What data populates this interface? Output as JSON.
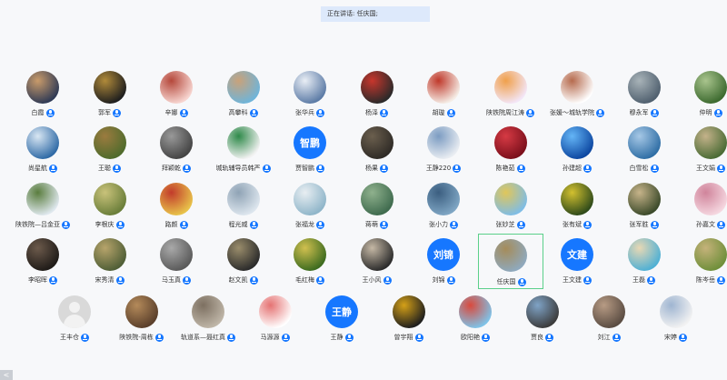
{
  "status": {
    "speaking_text": "正在讲话: 任庆国;"
  },
  "participants": [
    {
      "name": "白霞",
      "colors": [
        "#2f3a55",
        "#c99b6a"
      ]
    },
    {
      "name": "郭军",
      "colors": [
        "#1e1e1e",
        "#b08a3a"
      ]
    },
    {
      "name": "辛娜",
      "colors": [
        "#f7d5d0",
        "#b5483b"
      ]
    },
    {
      "name": "高攀科",
      "colors": [
        "#6fb4d9",
        "#c9a27a"
      ]
    },
    {
      "name": "张华兵",
      "colors": [
        "#5c7ba6",
        "#e9eef5"
      ]
    },
    {
      "name": "杨泽",
      "colors": [
        "#2a2a2a",
        "#c7362c"
      ]
    },
    {
      "name": "胡璇",
      "colors": [
        "#f5ede6",
        "#c0392b"
      ]
    },
    {
      "name": "陕铁院周江涛",
      "colors": [
        "#f3e6f7",
        "#f0a04b"
      ]
    },
    {
      "name": "张媛～城轨学院",
      "colors": [
        "#ffffff",
        "#b66b4e"
      ]
    },
    {
      "name": "穆永军",
      "colors": [
        "#50606f",
        "#a8b3b8"
      ]
    },
    {
      "name": "仲明",
      "colors": [
        "#3c6a2f",
        "#a9c48d"
      ]
    },
    {
      "name": "尚星航",
      "colors": [
        "#2f6aa6",
        "#d9e7f3"
      ]
    },
    {
      "name": "王聪",
      "colors": [
        "#4f6b2c",
        "#9b7b3f"
      ]
    },
    {
      "name": "拜颖乾",
      "colors": [
        "#444",
        "#999"
      ]
    },
    {
      "name": "城轨辅导员韩严",
      "colors": [
        "#f2f2f2",
        "#2f8a4a"
      ]
    },
    {
      "name": "贾智鹏",
      "text": "智鹏"
    },
    {
      "name": "杨果",
      "colors": [
        "#2f2b26",
        "#6b5f4e"
      ]
    },
    {
      "name": "王静220",
      "colors": [
        "#e9edf2",
        "#7c9cc2"
      ]
    },
    {
      "name": "陈艳茹",
      "colors": [
        "#7b0f1b",
        "#d63a44"
      ]
    },
    {
      "name": "孙建超",
      "colors": [
        "#0d47a1",
        "#64b5f6"
      ]
    },
    {
      "name": "白雪松",
      "colors": [
        "#2f6ea5",
        "#a6c8e6"
      ]
    },
    {
      "name": "王文娟",
      "colors": [
        "#4a6b35",
        "#c4b28a"
      ]
    },
    {
      "name": "陕铁院—吕金亚",
      "colors": [
        "#dfe8ee",
        "#5a7d3e"
      ]
    },
    {
      "name": "李根庆",
      "colors": [
        "#6a7e3a",
        "#c9c27a"
      ]
    },
    {
      "name": "路颜",
      "colors": [
        "#e8c34a",
        "#c23b2b"
      ]
    },
    {
      "name": "程光威",
      "colors": [
        "#dde6ee",
        "#8fa3b5"
      ]
    },
    {
      "name": "张福龙",
      "colors": [
        "#8fb5c9",
        "#e8eef2"
      ]
    },
    {
      "name": "蒋萌",
      "colors": [
        "#3f6b4e",
        "#8fb18d"
      ]
    },
    {
      "name": "张小力",
      "colors": [
        "#7fa6c4",
        "#3b5e80"
      ]
    },
    {
      "name": "张妙芝",
      "colors": [
        "#7fbde6",
        "#e0c65a"
      ]
    },
    {
      "name": "张有斌",
      "colors": [
        "#2e4a1a",
        "#d2c02f"
      ]
    },
    {
      "name": "张军胜",
      "colors": [
        "#3b4a2a",
        "#c7b48a"
      ]
    },
    {
      "name": "孙嘉文",
      "colors": [
        "#f5d7e0",
        "#d0849b"
      ]
    },
    {
      "name": "李昭晖",
      "colors": [
        "#1f1b18",
        "#6c5a4b"
      ]
    },
    {
      "name": "宋秀清",
      "colors": [
        "#4f5e36",
        "#b7a46b"
      ]
    },
    {
      "name": "马玉真",
      "colors": [
        "#5a5a5a",
        "#a9a9a9"
      ]
    },
    {
      "name": "赵文凯",
      "colors": [
        "#2b2b2b",
        "#9a8d6b"
      ]
    },
    {
      "name": "毛红梅",
      "colors": [
        "#3c6b1f",
        "#d1c04f"
      ]
    },
    {
      "name": "王小风",
      "colors": [
        "#2b2b2b",
        "#c5b8a5"
      ]
    },
    {
      "name": "刘锦",
      "text": "刘锦"
    },
    {
      "name": "任庆国",
      "colors": [
        "#8fa9be",
        "#a58c5a"
      ],
      "highlight": true
    },
    {
      "name": "王文建",
      "text": "文建"
    },
    {
      "name": "王磊",
      "colors": [
        "#4fb0d4",
        "#e8d8b4"
      ]
    },
    {
      "name": "陈岑岳",
      "colors": [
        "#6f8f3a",
        "#c5b27a"
      ]
    },
    {
      "name": "王丰仓",
      "empty": true
    },
    {
      "name": "陕铁院-周栋",
      "colors": [
        "#5a3f2b",
        "#b48a5a"
      ]
    },
    {
      "name": "轨道系—聂红真",
      "colors": [
        "#bfb6a8",
        "#7d7061"
      ]
    },
    {
      "name": "马源源",
      "colors": [
        "#ffffff",
        "#e57373"
      ]
    },
    {
      "name": "王静",
      "text": "王静"
    },
    {
      "name": "曾宇翔",
      "colors": [
        "#1e1e1e",
        "#d4a017"
      ]
    },
    {
      "name": "欧阳艳",
      "colors": [
        "#7fc3e8",
        "#d94a3d"
      ]
    },
    {
      "name": "贾良",
      "colors": [
        "#3b3b3b",
        "#7fa3c6"
      ]
    },
    {
      "name": "刘江",
      "colors": [
        "#5a4c42",
        "#b79b84"
      ]
    },
    {
      "name": "宋婷",
      "colors": [
        "#f2f2f2",
        "#9fb5d1"
      ]
    }
  ],
  "nav": {
    "back_label": "<"
  }
}
